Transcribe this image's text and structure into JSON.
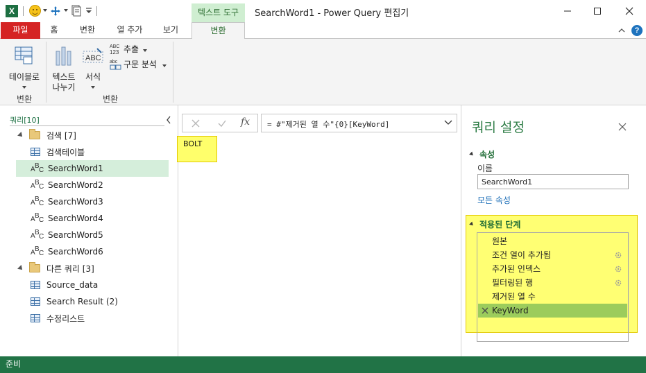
{
  "window": {
    "title": "SearchWord1 - Power Query 편집기",
    "context_tab_header": "텍스트 도구"
  },
  "tabs": {
    "file": "파일",
    "home": "홈",
    "transform": "변환",
    "add_column": "열 추가",
    "view": "보기",
    "context_transform": "변환"
  },
  "ribbon": {
    "table_button": "테이블로",
    "group1_label": "변환",
    "split_text_line1": "텍스트",
    "split_text_line2": "나누기",
    "format_button": "서식",
    "extract_button": "추출",
    "parse_button": "구문 분석",
    "group2_label": "변환"
  },
  "queries": {
    "title": "쿼리[10]",
    "items": [
      {
        "label": "검색 [7]",
        "type": "folder"
      },
      {
        "label": "검색테이블",
        "type": "table"
      },
      {
        "label": "SearchWord1",
        "type": "text",
        "selected": true
      },
      {
        "label": "SearchWord2",
        "type": "text"
      },
      {
        "label": "SearchWord3",
        "type": "text"
      },
      {
        "label": "SearchWord4",
        "type": "text"
      },
      {
        "label": "SearchWord5",
        "type": "text"
      },
      {
        "label": "SearchWord6",
        "type": "text"
      },
      {
        "label": "다른 쿼리 [3]",
        "type": "folder"
      },
      {
        "label": "Source_data",
        "type": "table"
      },
      {
        "label": "Search Result (2)",
        "type": "table"
      },
      {
        "label": "수정리스트",
        "type": "table"
      }
    ]
  },
  "formula": {
    "text": "= #\"제거된 열 수\"{0}[KeyWord]"
  },
  "result": {
    "value": "BOLT"
  },
  "settings": {
    "title": "쿼리 설정",
    "properties_header": "속성",
    "name_label": "이름",
    "name_value": "SearchWord1",
    "all_properties_link": "모든 속성",
    "applied_steps_header": "적용된 단계",
    "steps": [
      {
        "label": "원본",
        "gear": false
      },
      {
        "label": "조건 열이 추가됨",
        "gear": true
      },
      {
        "label": "추가된 인덱스",
        "gear": true
      },
      {
        "label": "필터링된 행",
        "gear": true
      },
      {
        "label": "제거된 열 수",
        "gear": false
      },
      {
        "label": "KeyWord",
        "gear": false,
        "selected": true
      }
    ]
  },
  "status": {
    "text": "준비"
  },
  "colors": {
    "accent_green": "#217346",
    "file_tab_red": "#d52424",
    "highlight_yellow": "#ffff6b",
    "selected_step": "#9ccc5c"
  }
}
